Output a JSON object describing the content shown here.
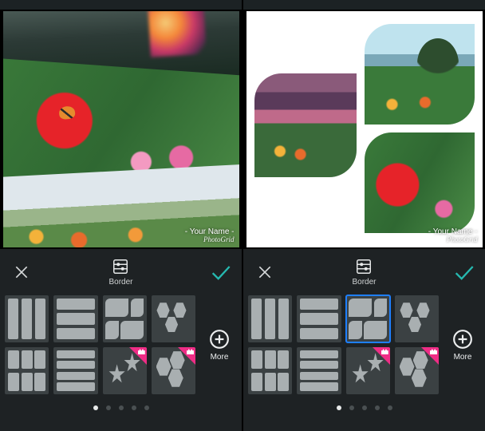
{
  "watermark": {
    "name_line": "- Your Name -",
    "brand": "PhotoGrid"
  },
  "toolbar": {
    "section_label": "Border"
  },
  "more": {
    "label": "More"
  },
  "pager": {
    "total": 5,
    "active_index": 0
  },
  "layouts": {
    "row1": [
      "columns-3",
      "rows-3",
      "mosaic-4",
      "hex-grid"
    ],
    "row2": [
      "grid-6",
      "rows-4",
      "stars",
      "hex-mosaic"
    ],
    "premium_indices_row2": [
      2,
      3
    ]
  },
  "right_selected_layout": "mosaic-4",
  "colors": {
    "accent_check": "#26b9b0",
    "accent_select": "#1e7fff",
    "accent_premium": "#ef2d86"
  }
}
